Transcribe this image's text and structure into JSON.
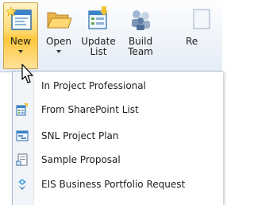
{
  "ribbon": {
    "buttons": [
      {
        "label": "New",
        "icon": "new-document-icon",
        "has_dropdown": true
      },
      {
        "label": "Open",
        "icon": "open-folder-icon",
        "has_dropdown": true
      },
      {
        "label": "Update List",
        "icon": "update-list-icon"
      },
      {
        "label": "Build Team",
        "icon": "build-team-icon"
      },
      {
        "label": "Re",
        "icon": "resource-icon"
      }
    ]
  },
  "new_menu": {
    "items": [
      {
        "label": "In Project Professional",
        "icon": null
      },
      {
        "label": "From SharePoint List",
        "icon": "sharepoint-list-icon"
      },
      {
        "label": "SNL Project Plan",
        "icon": "project-plan-icon"
      },
      {
        "label": "Sample Proposal",
        "icon": "sample-proposal-icon"
      },
      {
        "label": "EIS Business Portfolio Request",
        "icon": "portfolio-request-icon"
      }
    ]
  }
}
